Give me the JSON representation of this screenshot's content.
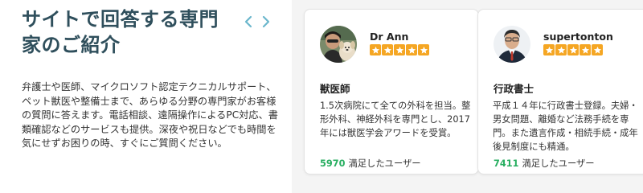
{
  "section": {
    "heading_line1": "サイトで回答する専門",
    "heading_line2": "家のご紹介",
    "description": "弁護士や医師、マイクロソフト認定テクニカルサポート、ペット獣医や整備士まで、あらゆる分野の専門家がお客様の質問に答えます。電話相談、遠隔操作によるPC対応、書類確認などのサービスも提供。深夜や祝日などでも時間を気にせずお困りの時、すぐにご質問ください。"
  },
  "nav": {
    "prev_icon": "chevron-left-icon",
    "next_icon": "chevron-right-icon"
  },
  "experts": [
    {
      "name": "Dr Ann",
      "rating": 5,
      "title": "獣医師",
      "body": "1.5次病院にて全ての外科を担当。整形外科、神経外科を専門とし、2017年には獣医学会アワードを受賞。",
      "count": "5970",
      "count_label": "満足したユーザー"
    },
    {
      "name": "supertonton",
      "rating": 5,
      "title": "行政書士",
      "body": "平成１４年に行政書士登録。夫婦・男女問題、離婚など法務手続を専門。また遺言作成・相続手続・成年後見制度にも精通。",
      "count": "7411",
      "count_label": "満足したユーザー"
    }
  ],
  "colors": {
    "heading": "#2f4f5c",
    "nav_arrow": "#6bb7cc",
    "star": "#f5a623",
    "count": "#27ae60",
    "panel_bg": "#f4f4f4"
  }
}
